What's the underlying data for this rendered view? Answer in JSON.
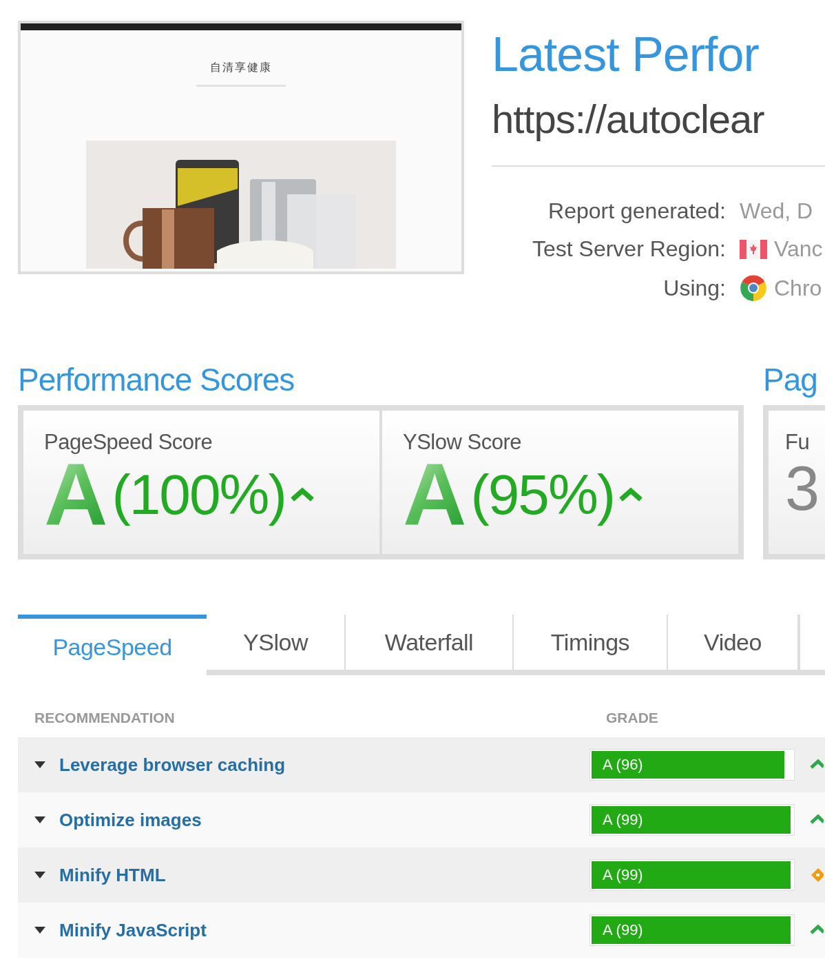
{
  "thumbnail": {
    "site_title": "自清享健康",
    "kind": "picture"
  },
  "header": {
    "title": "Latest Perfor",
    "url": "https://autoclear"
  },
  "report_info": [
    {
      "label": "Report generated:",
      "value": "Wed, D",
      "kind": "text"
    },
    {
      "label": "Test Server Region:",
      "value": "Vanc",
      "kind": "flag"
    },
    {
      "label": "Using:",
      "value": "Chro",
      "kind": "browser"
    }
  ],
  "performance_scores": {
    "title": "Performance Scores",
    "cards": [
      {
        "label": "PageSpeed Score",
        "grade": "A",
        "percent": "(100%)"
      },
      {
        "label": "YSlow Score",
        "grade": "A",
        "percent": "(95%)"
      }
    ]
  },
  "page_details": {
    "title": "Pag",
    "card": {
      "label": "Fu",
      "value": "3"
    }
  },
  "tabs": [
    {
      "label": "PageSpeed",
      "selected": true
    },
    {
      "label": "YSlow",
      "selected": false
    },
    {
      "label": "Waterfall",
      "selected": false
    },
    {
      "label": "Timings",
      "selected": false
    },
    {
      "label": "Video",
      "selected": false
    }
  ],
  "table": {
    "columns": [
      "RECOMMENDATION",
      "GRADE"
    ],
    "rows": [
      {
        "recommendation": "Leverage browser caching",
        "grade": "A (96)",
        "level": 0.96,
        "kind": "up"
      },
      {
        "recommendation": "Optimize images",
        "grade": "A (99)",
        "level": 0.99,
        "kind": "up"
      },
      {
        "recommendation": "Minify HTML",
        "grade": "A (99)",
        "level": 0.99,
        "kind": "same"
      },
      {
        "recommendation": "Minify JavaScript",
        "grade": "A (99)",
        "level": 0.99,
        "kind": "up"
      }
    ]
  }
}
